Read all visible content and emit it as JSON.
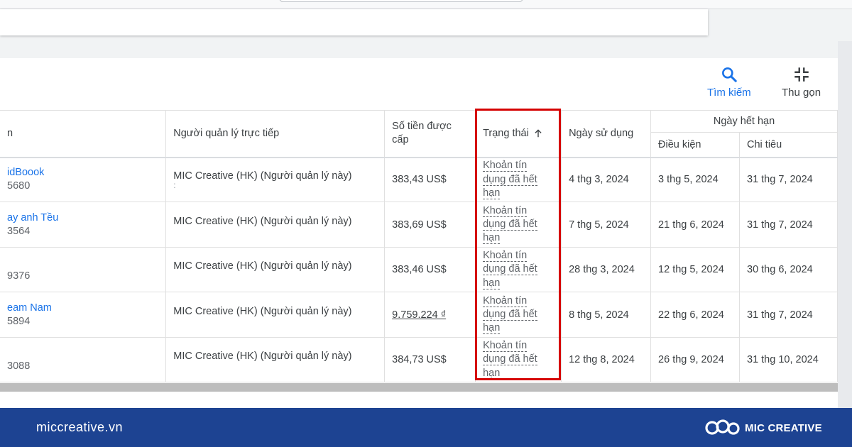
{
  "toolbar": {
    "search_label": "Tìm kiếm",
    "collapse_label": "Thu gọn"
  },
  "table": {
    "headers": {
      "name": "n",
      "manager": "Người quản lý trực tiếp",
      "amount": "Số tiền được cấp",
      "status": "Trạng thái",
      "usage_date": "Ngày sử dụng",
      "expiry_group": "Ngày hết hạn",
      "expiry_condition": "Điều kiện",
      "expiry_spend": "Chi tiêu"
    },
    "rows": [
      {
        "name": "idBoook",
        "id": "5680",
        "manager": "MIC Creative (HK) (Người quản lý này)",
        "manager_sub": ":",
        "amount": "383,43 US$",
        "status": "Khoản tín dụng đã hết hạn",
        "usage_date": "4 thg 3, 2024",
        "expiry_condition": "3 thg 5, 2024",
        "expiry_spend": "31 thg 7, 2024"
      },
      {
        "name": "ay anh Tều",
        "id": "3564",
        "manager": "MIC Creative (HK) (Người quản lý này)",
        "manager_sub": "",
        "amount": "383,69 US$",
        "status": "Khoản tín dụng đã hết hạn",
        "usage_date": "7 thg 5, 2024",
        "expiry_condition": "21 thg 6, 2024",
        "expiry_spend": "31 thg 7, 2024"
      },
      {
        "name": "",
        "id": "9376",
        "manager": "MIC Creative (HK) (Người quản lý này)",
        "manager_sub": "",
        "amount": "383,46 US$",
        "status": "Khoản tín dụng đã hết hạn",
        "usage_date": "28 thg 3, 2024",
        "expiry_condition": "12 thg 5, 2024",
        "expiry_spend": "30 thg 6, 2024"
      },
      {
        "name": "eam Nam",
        "id": "5894",
        "manager": "MIC Creative (HK) (Người quản lý này)",
        "manager_sub": "",
        "amount": "9.759.224 ₫",
        "status": "Khoản tín dụng đã hết hạn",
        "usage_date": "8 thg 5, 2024",
        "expiry_condition": "22 thg 6, 2024",
        "expiry_spend": "31 thg 7, 2024"
      },
      {
        "name": "",
        "id": "3088",
        "manager": "MIC Creative (HK) (Người quản lý này)",
        "manager_sub": "",
        "amount": "384,73 US$",
        "status": "Khoản tín dụng đã hết hạn",
        "usage_date": "12 thg 8, 2024",
        "expiry_condition": "26 thg 9, 2024",
        "expiry_spend": "31 thg 10, 2024"
      }
    ]
  },
  "footer": {
    "url": "miccreative.vn",
    "brand": "MIC CREATIVE"
  },
  "colors": {
    "accent": "#1a73e8",
    "highlight": "#d50000",
    "footer_bg": "#1d4392"
  }
}
